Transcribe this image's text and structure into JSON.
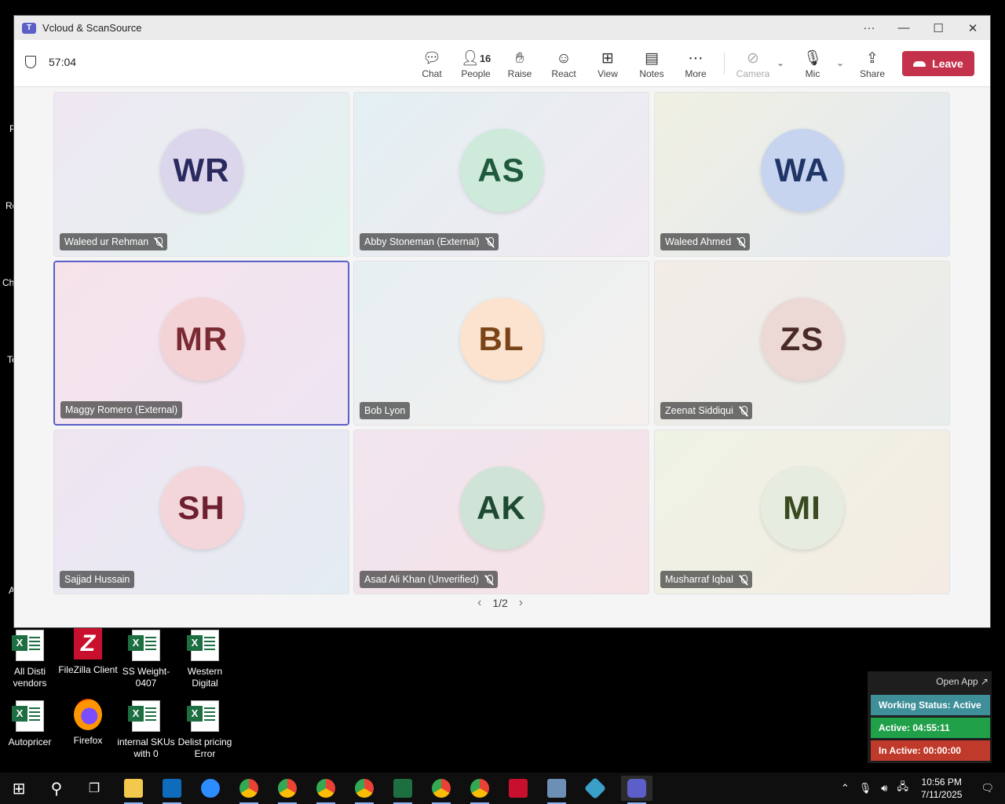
{
  "desktop": {
    "edge_fragments": [
      "P",
      "Re",
      "Ch",
      "Te",
      "A"
    ],
    "icons": [
      {
        "label": "All Disti vendors",
        "type": "excel"
      },
      {
        "label": "FileZilla Client",
        "type": "filezilla"
      },
      {
        "label": "SS Weight-0407",
        "type": "excel"
      },
      {
        "label": "Western Digital",
        "type": "excel"
      },
      {
        "label": "Autopricer",
        "type": "excel"
      },
      {
        "label": "Firefox",
        "type": "firefox"
      },
      {
        "label": "internal SKUs with 0",
        "type": "excel"
      },
      {
        "label": "Delist pricing Error",
        "type": "excel"
      }
    ]
  },
  "window": {
    "title": "Vcloud & ScanSource",
    "controls": {
      "more": "···",
      "minimize": "—",
      "maximize": "☐",
      "close": "✕"
    }
  },
  "meeting": {
    "timer": "57:04",
    "toolbar": {
      "chat": "Chat",
      "people": "People",
      "people_count": "16",
      "raise": "Raise",
      "react": "React",
      "view": "View",
      "notes": "Notes",
      "more": "More",
      "camera": "Camera",
      "mic": "Mic",
      "share": "Share",
      "leave": "Leave"
    },
    "participants": [
      {
        "initials": "WR",
        "name": "Waleed ur Rehman",
        "muted": true,
        "bg": "#dcd6ec",
        "fg": "#2b2a5e",
        "tile": "linear-gradient(135deg,#efe7f3,#e2f4ee)"
      },
      {
        "initials": "AS",
        "name": "Abby Stoneman (External)",
        "muted": true,
        "bg": "#cdeadb",
        "fg": "#1f5a3c",
        "tile": "linear-gradient(135deg,#e3f0f3,#f1e9f1)"
      },
      {
        "initials": "WA",
        "name": "Waleed Ahmed",
        "muted": true,
        "bg": "#c6d4ef",
        "fg": "#1f3566",
        "tile": "linear-gradient(135deg,#f0f0e2,#e3e8f3)"
      },
      {
        "initials": "MR",
        "name": "Maggy Romero (External)",
        "muted": false,
        "bg": "#f3d3d6",
        "fg": "#7a2a33",
        "tile": "linear-gradient(135deg,#f6e3ea,#eee5f3)"
      },
      {
        "initials": "BL",
        "name": "Bob Lyon",
        "muted": false,
        "bg": "#fbe3cf",
        "fg": "#7a4418",
        "tile": "linear-gradient(135deg,#e7eff3,#f4f0ee)"
      },
      {
        "initials": "ZS",
        "name": "Zeenat Siddiqui",
        "muted": true,
        "bg": "#ecd9d6",
        "fg": "#4a2a26",
        "tile": "linear-gradient(135deg,#f3ece7,#e8ecea)"
      },
      {
        "initials": "SH",
        "name": "Sajjad Hussain",
        "muted": false,
        "bg": "#f3d6d9",
        "fg": "#6e2030",
        "tile": "linear-gradient(135deg,#efe5f1,#e4ecf3)"
      },
      {
        "initials": "AK",
        "name": "Asad Ali Khan (Unverified)",
        "muted": true,
        "bg": "#cfe3d6",
        "fg": "#1e4a32",
        "tile": "linear-gradient(135deg,#f1e5ef,#f5e3e6)"
      },
      {
        "initials": "MI",
        "name": "Musharraf Iqbal",
        "muted": true,
        "bg": "#e6ecdf",
        "fg": "#3b4a20",
        "tile": "linear-gradient(135deg,#eef3e4,#f4ece4)"
      }
    ],
    "pager": {
      "prev": "‹",
      "label": "1/2",
      "next": "›"
    }
  },
  "status_widget": {
    "open_app": "Open App ↗",
    "working_status": "Working Status: Active",
    "active": "Active: 04:55:11",
    "inactive": "In Active: 00:00:00",
    "colors": {
      "working": "#3f8f99",
      "active": "#21a04a",
      "inactive": "#c03a2b"
    }
  },
  "taskbar": {
    "apps": [
      "start",
      "search",
      "task-view",
      "file-explorer",
      "outlook",
      "zoom",
      "chrome",
      "chrome",
      "chrome",
      "chrome",
      "excel",
      "chrome",
      "chrome",
      "filezilla",
      "calculator",
      "app",
      "teams"
    ],
    "clock_time": "10:56 PM",
    "clock_date": "7/11/2025"
  }
}
